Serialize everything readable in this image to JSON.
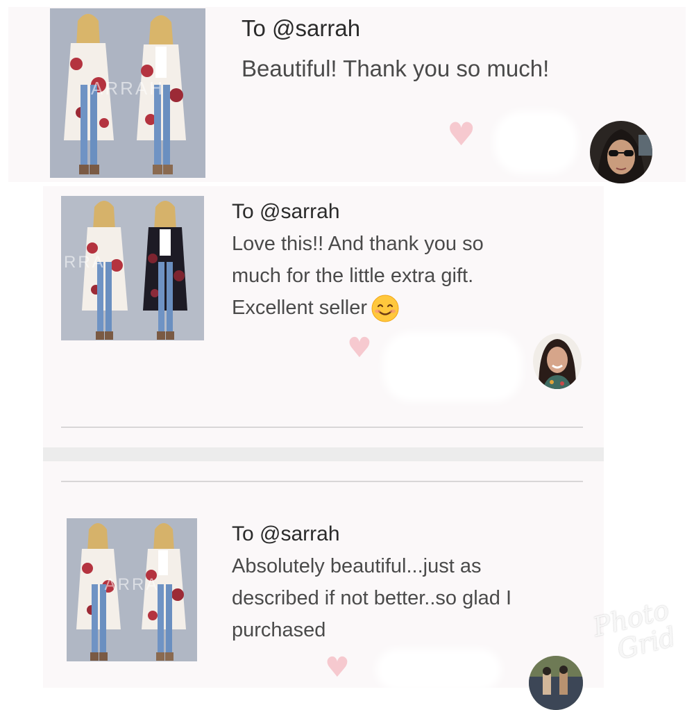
{
  "reviews": [
    {
      "recipient": "To @sarrah",
      "message": "Beautiful! Thank you so much!",
      "watermark": "ARRAH"
    },
    {
      "recipient": "To @sarrah",
      "message_lines": [
        "Love this!! And thank you so",
        "much for the little extra gift.",
        "Excellent seller"
      ],
      "emoji": "smiling-face-emoji",
      "watermark": "RRA"
    },
    {
      "recipient": "To @sarrah",
      "message_lines": [
        "Absolutely beautiful...just as",
        "described if not better..so glad I",
        "purchased"
      ],
      "watermark": "ARRA"
    }
  ],
  "colors": {
    "heart": "#f6c9cf",
    "card_bg": "#fbf8f9",
    "text_dark": "#2b2b2b",
    "text_body": "#4a4a4a"
  },
  "logo": {
    "text_line1": "Photo",
    "text_line2": "Grid"
  }
}
